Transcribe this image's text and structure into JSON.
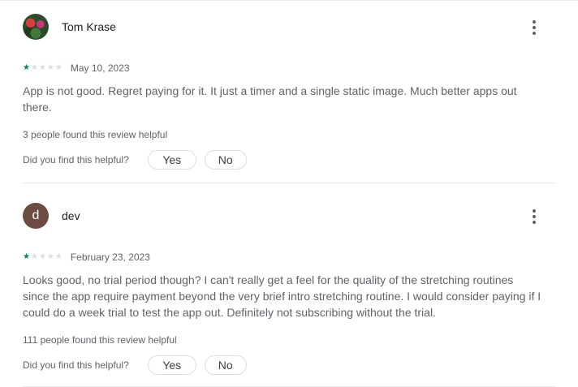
{
  "reviews": [
    {
      "author": "Tom Krase",
      "avatar_type": "photo",
      "rating": 1,
      "max_rating": 5,
      "date": "May 10, 2023",
      "text": "App is not good. Regret paying for it. It just a timer and a single static image. Much better apps out there.",
      "helpful_count_text": "3 people found this review helpful",
      "vote_question": "Did you find this helpful?",
      "yes_label": "Yes",
      "no_label": "No"
    },
    {
      "author": "dev",
      "avatar_type": "letter",
      "avatar_letter": "d",
      "avatar_color": "#6d4c41",
      "rating": 1,
      "max_rating": 5,
      "date": "February 23, 2023",
      "text": "Looks good, no trial period though? I can't really get a feel for the quality of the stretching routines since the app require payment beyond the very brief intro stretching routine. I would consider paying if I could do a week trial to test the app out. Definitely not subscribing without the trial.",
      "helpful_count_text": "111 people found this review helpful",
      "vote_question": "Did you find this helpful?",
      "yes_label": "Yes",
      "no_label": "No"
    }
  ],
  "icons": {
    "more": "more-vert-icon",
    "star": "star-icon"
  },
  "colors": {
    "star_filled": "#01875f",
    "star_empty": "#dadce0"
  }
}
